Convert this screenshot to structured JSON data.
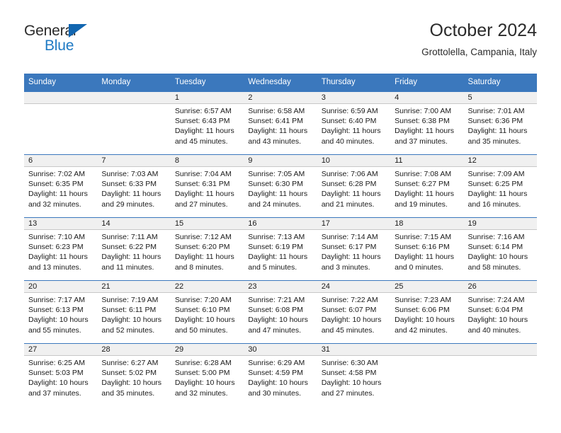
{
  "brand": {
    "name_top": "General",
    "name_bottom": "Blue",
    "accent_color": "#1f7ac4",
    "triangle_color": "#1266b0"
  },
  "header": {
    "title": "October 2024",
    "subtitle": "Grottolella, Campania, Italy"
  },
  "theme": {
    "header_row_bg": "#3b78bd",
    "header_row_text": "#ffffff",
    "day_band_bg": "#f0f0f0",
    "grid_line": "#3b78bd"
  },
  "weekdays": [
    "Sunday",
    "Monday",
    "Tuesday",
    "Wednesday",
    "Thursday",
    "Friday",
    "Saturday"
  ],
  "weeks": [
    [
      {
        "day": "",
        "sunrise": "",
        "sunset": "",
        "daylight1": "",
        "daylight2": ""
      },
      {
        "day": "",
        "sunrise": "",
        "sunset": "",
        "daylight1": "",
        "daylight2": ""
      },
      {
        "day": "1",
        "sunrise": "Sunrise: 6:57 AM",
        "sunset": "Sunset: 6:43 PM",
        "daylight1": "Daylight: 11 hours",
        "daylight2": "and 45 minutes."
      },
      {
        "day": "2",
        "sunrise": "Sunrise: 6:58 AM",
        "sunset": "Sunset: 6:41 PM",
        "daylight1": "Daylight: 11 hours",
        "daylight2": "and 43 minutes."
      },
      {
        "day": "3",
        "sunrise": "Sunrise: 6:59 AM",
        "sunset": "Sunset: 6:40 PM",
        "daylight1": "Daylight: 11 hours",
        "daylight2": "and 40 minutes."
      },
      {
        "day": "4",
        "sunrise": "Sunrise: 7:00 AM",
        "sunset": "Sunset: 6:38 PM",
        "daylight1": "Daylight: 11 hours",
        "daylight2": "and 37 minutes."
      },
      {
        "day": "5",
        "sunrise": "Sunrise: 7:01 AM",
        "sunset": "Sunset: 6:36 PM",
        "daylight1": "Daylight: 11 hours",
        "daylight2": "and 35 minutes."
      }
    ],
    [
      {
        "day": "6",
        "sunrise": "Sunrise: 7:02 AM",
        "sunset": "Sunset: 6:35 PM",
        "daylight1": "Daylight: 11 hours",
        "daylight2": "and 32 minutes."
      },
      {
        "day": "7",
        "sunrise": "Sunrise: 7:03 AM",
        "sunset": "Sunset: 6:33 PM",
        "daylight1": "Daylight: 11 hours",
        "daylight2": "and 29 minutes."
      },
      {
        "day": "8",
        "sunrise": "Sunrise: 7:04 AM",
        "sunset": "Sunset: 6:31 PM",
        "daylight1": "Daylight: 11 hours",
        "daylight2": "and 27 minutes."
      },
      {
        "day": "9",
        "sunrise": "Sunrise: 7:05 AM",
        "sunset": "Sunset: 6:30 PM",
        "daylight1": "Daylight: 11 hours",
        "daylight2": "and 24 minutes."
      },
      {
        "day": "10",
        "sunrise": "Sunrise: 7:06 AM",
        "sunset": "Sunset: 6:28 PM",
        "daylight1": "Daylight: 11 hours",
        "daylight2": "and 21 minutes."
      },
      {
        "day": "11",
        "sunrise": "Sunrise: 7:08 AM",
        "sunset": "Sunset: 6:27 PM",
        "daylight1": "Daylight: 11 hours",
        "daylight2": "and 19 minutes."
      },
      {
        "day": "12",
        "sunrise": "Sunrise: 7:09 AM",
        "sunset": "Sunset: 6:25 PM",
        "daylight1": "Daylight: 11 hours",
        "daylight2": "and 16 minutes."
      }
    ],
    [
      {
        "day": "13",
        "sunrise": "Sunrise: 7:10 AM",
        "sunset": "Sunset: 6:23 PM",
        "daylight1": "Daylight: 11 hours",
        "daylight2": "and 13 minutes."
      },
      {
        "day": "14",
        "sunrise": "Sunrise: 7:11 AM",
        "sunset": "Sunset: 6:22 PM",
        "daylight1": "Daylight: 11 hours",
        "daylight2": "and 11 minutes."
      },
      {
        "day": "15",
        "sunrise": "Sunrise: 7:12 AM",
        "sunset": "Sunset: 6:20 PM",
        "daylight1": "Daylight: 11 hours",
        "daylight2": "and 8 minutes."
      },
      {
        "day": "16",
        "sunrise": "Sunrise: 7:13 AM",
        "sunset": "Sunset: 6:19 PM",
        "daylight1": "Daylight: 11 hours",
        "daylight2": "and 5 minutes."
      },
      {
        "day": "17",
        "sunrise": "Sunrise: 7:14 AM",
        "sunset": "Sunset: 6:17 PM",
        "daylight1": "Daylight: 11 hours",
        "daylight2": "and 3 minutes."
      },
      {
        "day": "18",
        "sunrise": "Sunrise: 7:15 AM",
        "sunset": "Sunset: 6:16 PM",
        "daylight1": "Daylight: 11 hours",
        "daylight2": "and 0 minutes."
      },
      {
        "day": "19",
        "sunrise": "Sunrise: 7:16 AM",
        "sunset": "Sunset: 6:14 PM",
        "daylight1": "Daylight: 10 hours",
        "daylight2": "and 58 minutes."
      }
    ],
    [
      {
        "day": "20",
        "sunrise": "Sunrise: 7:17 AM",
        "sunset": "Sunset: 6:13 PM",
        "daylight1": "Daylight: 10 hours",
        "daylight2": "and 55 minutes."
      },
      {
        "day": "21",
        "sunrise": "Sunrise: 7:19 AM",
        "sunset": "Sunset: 6:11 PM",
        "daylight1": "Daylight: 10 hours",
        "daylight2": "and 52 minutes."
      },
      {
        "day": "22",
        "sunrise": "Sunrise: 7:20 AM",
        "sunset": "Sunset: 6:10 PM",
        "daylight1": "Daylight: 10 hours",
        "daylight2": "and 50 minutes."
      },
      {
        "day": "23",
        "sunrise": "Sunrise: 7:21 AM",
        "sunset": "Sunset: 6:08 PM",
        "daylight1": "Daylight: 10 hours",
        "daylight2": "and 47 minutes."
      },
      {
        "day": "24",
        "sunrise": "Sunrise: 7:22 AM",
        "sunset": "Sunset: 6:07 PM",
        "daylight1": "Daylight: 10 hours",
        "daylight2": "and 45 minutes."
      },
      {
        "day": "25",
        "sunrise": "Sunrise: 7:23 AM",
        "sunset": "Sunset: 6:06 PM",
        "daylight1": "Daylight: 10 hours",
        "daylight2": "and 42 minutes."
      },
      {
        "day": "26",
        "sunrise": "Sunrise: 7:24 AM",
        "sunset": "Sunset: 6:04 PM",
        "daylight1": "Daylight: 10 hours",
        "daylight2": "and 40 minutes."
      }
    ],
    [
      {
        "day": "27",
        "sunrise": "Sunrise: 6:25 AM",
        "sunset": "Sunset: 5:03 PM",
        "daylight1": "Daylight: 10 hours",
        "daylight2": "and 37 minutes."
      },
      {
        "day": "28",
        "sunrise": "Sunrise: 6:27 AM",
        "sunset": "Sunset: 5:02 PM",
        "daylight1": "Daylight: 10 hours",
        "daylight2": "and 35 minutes."
      },
      {
        "day": "29",
        "sunrise": "Sunrise: 6:28 AM",
        "sunset": "Sunset: 5:00 PM",
        "daylight1": "Daylight: 10 hours",
        "daylight2": "and 32 minutes."
      },
      {
        "day": "30",
        "sunrise": "Sunrise: 6:29 AM",
        "sunset": "Sunset: 4:59 PM",
        "daylight1": "Daylight: 10 hours",
        "daylight2": "and 30 minutes."
      },
      {
        "day": "31",
        "sunrise": "Sunrise: 6:30 AM",
        "sunset": "Sunset: 4:58 PM",
        "daylight1": "Daylight: 10 hours",
        "daylight2": "and 27 minutes."
      },
      {
        "day": "",
        "sunrise": "",
        "sunset": "",
        "daylight1": "",
        "daylight2": ""
      },
      {
        "day": "",
        "sunrise": "",
        "sunset": "",
        "daylight1": "",
        "daylight2": ""
      }
    ]
  ]
}
